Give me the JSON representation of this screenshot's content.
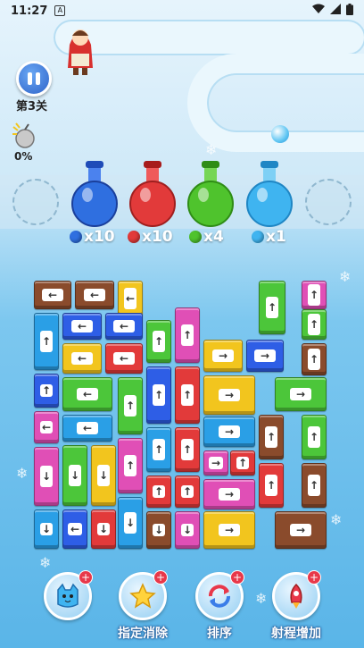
{
  "status": {
    "time": "11:27",
    "app_icon": "A"
  },
  "level": {
    "label": "第3关"
  },
  "progress": {
    "percent": "0%"
  },
  "flasks": [
    {
      "color": "#2f6fe0",
      "count": "x10"
    },
    {
      "color": "#e23a3a",
      "count": "x10"
    },
    {
      "color": "#4fc32d",
      "count": "x4"
    },
    {
      "color": "#3fb4f0",
      "count": "x1"
    }
  ],
  "boosters": [
    {
      "label": "",
      "icon": "cat-head-icon"
    },
    {
      "label": "指定消除",
      "icon": "star-icon"
    },
    {
      "label": "排序",
      "icon": "shuffle-icon"
    },
    {
      "label": "射程增加",
      "icon": "rocket-icon"
    }
  ],
  "board": {
    "blocks": [
      {
        "c": "#8a4b2c",
        "o": "h",
        "d": "←"
      },
      {
        "c": "#8a4b2c",
        "o": "h",
        "d": "←"
      },
      {
        "c": "#f2c51e",
        "o": "h",
        "d": "←"
      },
      {
        "c": "#4cc63a",
        "o": "v",
        "d": "↑"
      },
      {
        "c": "#e04fb6",
        "o": "v",
        "d": "↑"
      },
      {
        "c": "#2a9fe6",
        "o": "v",
        "d": "↑"
      },
      {
        "c": "#2e5ee6",
        "o": "h",
        "d": "←"
      },
      {
        "c": "#2e5ee6",
        "o": "h",
        "d": "←"
      },
      {
        "c": "#4cc63a",
        "o": "v",
        "d": "↑"
      },
      {
        "c": "#e04fb6",
        "o": "v",
        "d": "↑"
      },
      {
        "c": "#e04fb6",
        "o": "v",
        "d": "↑"
      },
      {
        "c": "#f2c51e",
        "o": "h",
        "d": "←"
      },
      {
        "c": "#e23a3a",
        "o": "h",
        "d": "←"
      },
      {
        "c": "#2e5ee6",
        "o": "h",
        "d": "→"
      },
      {
        "c": "#f2c51e",
        "o": "h",
        "d": "→"
      },
      {
        "c": "#8a4b2c",
        "o": "v",
        "d": "↑"
      }
    ]
  }
}
